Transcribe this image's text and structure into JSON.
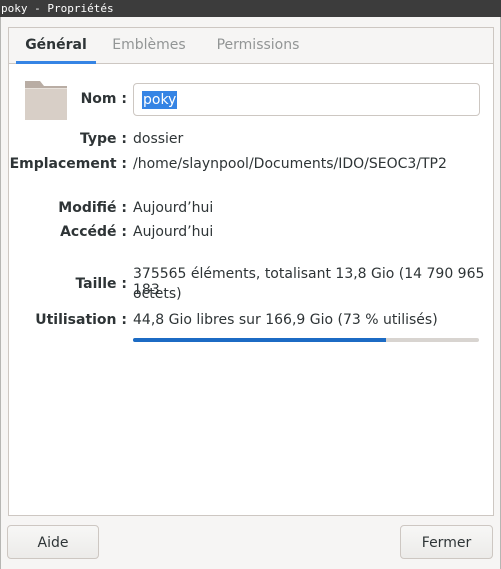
{
  "window": {
    "title": "poky - Propriétés"
  },
  "tabs": [
    {
      "label": "Général",
      "active": true
    },
    {
      "label": "Emblèmes",
      "active": false
    },
    {
      "label": "Permissions",
      "active": false
    }
  ],
  "icon": "folder-icon",
  "fields": {
    "name_label": "Nom :",
    "name_value": "poky",
    "type_label": "Type :",
    "type_value": "dossier",
    "location_label": "Emplacement :",
    "location_value": "/home/slaynpool/Documents/IDO/SEOC3/TP2",
    "modified_label": "Modifié :",
    "modified_value": "Aujourd’hui",
    "accessed_label": "Accédé :",
    "accessed_value": "Aujourd’hui",
    "size_label": "Taille :",
    "size_line1": "375565 éléments, totalisant 13,8 Gio (14 790 965 183",
    "size_line2": "octets)",
    "usage_label": "Utilisation :",
    "usage_value": "44,8 Gio libres sur 166,9 Gio (73 % utilisés)",
    "usage_fraction": 0.73
  },
  "buttons": {
    "help": "Aide",
    "close": "Fermer"
  },
  "colors": {
    "accent": "#3584e4",
    "usage_fill": "#1c6bc4",
    "titlebar": "#3c3c3c"
  }
}
